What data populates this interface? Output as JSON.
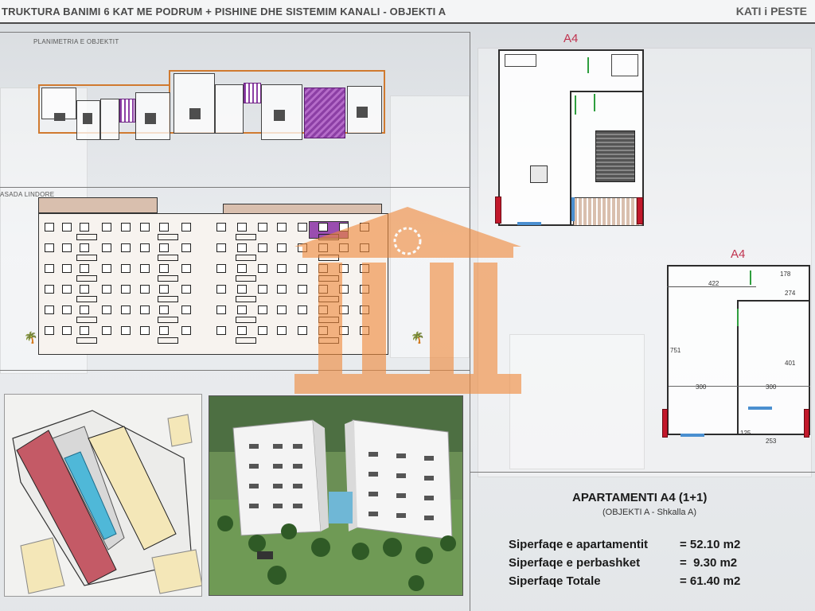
{
  "header": {
    "title": "TRUKTURA BANIMI 6 KAT ME PODRUM + PISHINE DHE SISTEMIM KANALI   -  OBJEKTI A",
    "floor_label": "KATI i PESTE"
  },
  "sections": {
    "plan_label": "PLANIMETRIA E OBJEKTIT",
    "facade_label": "ASADA LINDORE"
  },
  "apartment_plan": {
    "label_top": "A4",
    "label_bottom": "A4",
    "dimensions": {
      "d422": "422",
      "d178": "178",
      "d274": "274",
      "d401": "401",
      "d751": "751",
      "d300a": "300",
      "d300b": "300",
      "d253": "253",
      "d125": "125"
    }
  },
  "info": {
    "title": "APARTAMENTI A4 (1+1)",
    "subtitle": "(OBJEKTI A - Shkalla A)",
    "rows": [
      {
        "label": "Siperfaqe e apartamentit",
        "value": "= 52.10 m2"
      },
      {
        "label": "Siperfaqe e perbashket",
        "value": "=  9.30 m2"
      },
      {
        "label": "Siperfaqe Totale",
        "value": "= 61.40 m2"
      }
    ]
  },
  "colors": {
    "accent_red": "#c2182b",
    "highlight_purple": "#8c3fa5",
    "watermark_orange": "#f08a3c",
    "door_green": "#2e9e3e"
  }
}
